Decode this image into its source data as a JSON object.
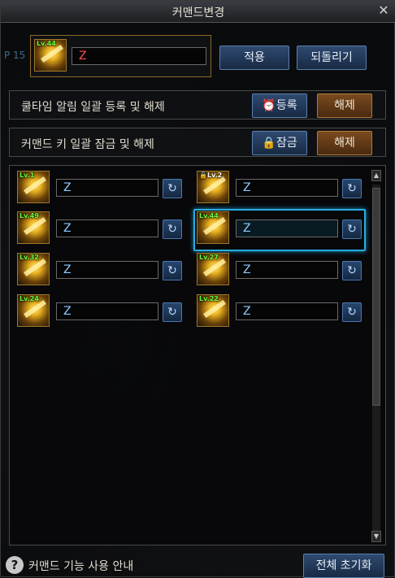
{
  "window": {
    "title": "커맨드변경",
    "close_icon": "close-icon"
  },
  "background_fragment": "P 15",
  "selected": {
    "level": "Lv.44",
    "command": "Z"
  },
  "top_buttons": {
    "apply": "적용",
    "revert": "되돌리기"
  },
  "cooldown_row": {
    "label": "쿨타임 알림 일괄 등록 및 해제",
    "register_label": "등록",
    "register_icon": "alarm-clock-icon",
    "release_label": "해제"
  },
  "lock_row": {
    "label": "커맨드 키 일괄 잠금 및 해제",
    "lock_label": "잠금",
    "lock_icon": "lock-icon",
    "release_label": "해제"
  },
  "skills": [
    {
      "level": "Lv.1",
      "command": "Z",
      "locked": false
    },
    {
      "level": "Lv.2",
      "command": "Z",
      "locked": true
    },
    {
      "level": "Lv.49",
      "command": "Z",
      "locked": false
    },
    {
      "level": "Lv.44",
      "command": "Z",
      "locked": false,
      "selected": true
    },
    {
      "level": "Lv.32",
      "command": "Z",
      "locked": false
    },
    {
      "level": "Lv.27",
      "command": "Z",
      "locked": false
    },
    {
      "level": "Lv.24",
      "command": "Z",
      "locked": false
    },
    {
      "level": "Lv.22",
      "command": "Z",
      "locked": false
    }
  ],
  "footer": {
    "help_icon": "question-mark-icon",
    "help_label": "커맨드 기능 사용 안내",
    "reset_all_label": "전체 초기화"
  },
  "colors": {
    "level_green": "#6aff3a",
    "command_blue": "#8ecaff",
    "selected_command_red": "#ff4a4a",
    "selection_highlight": "#28aee0"
  }
}
